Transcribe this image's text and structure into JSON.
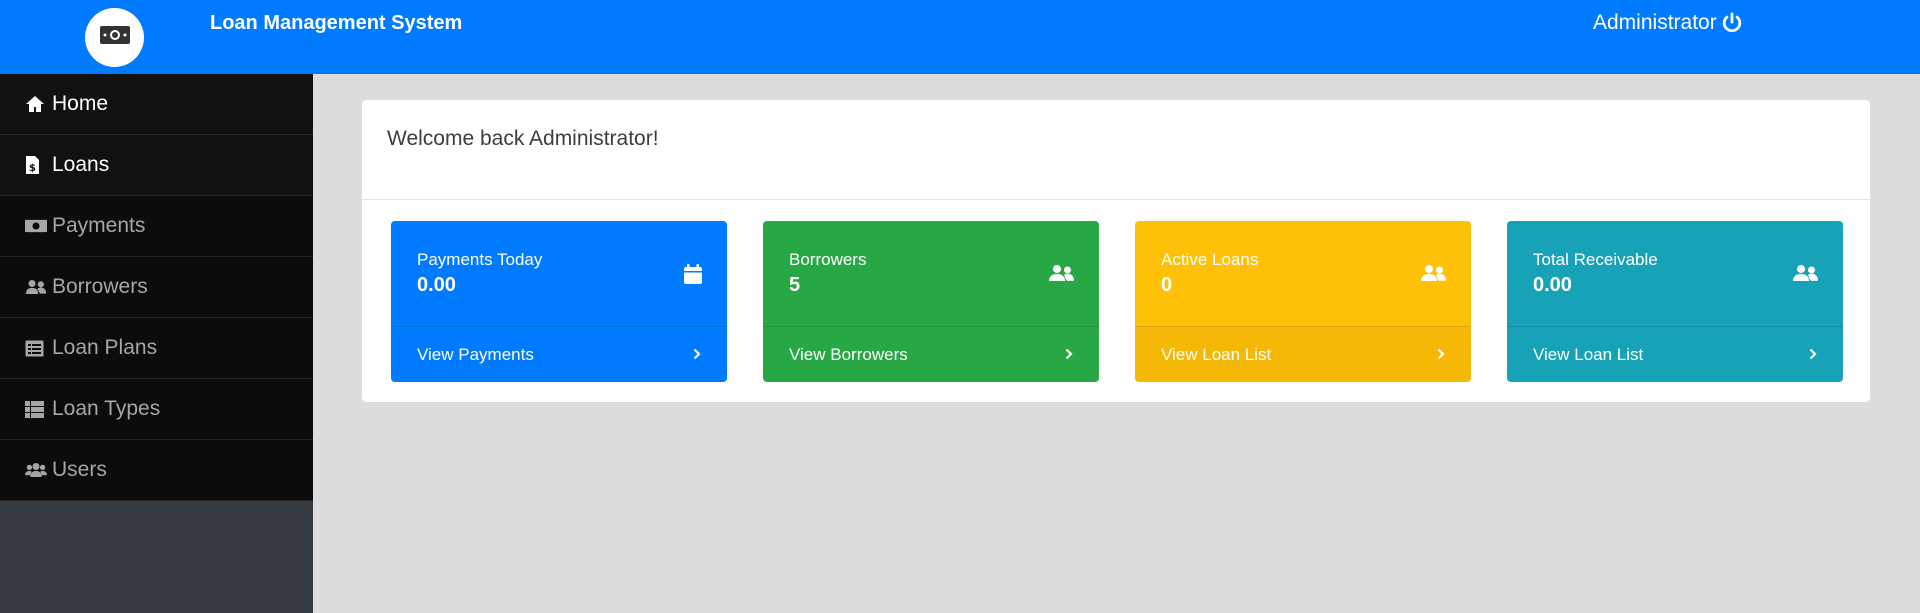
{
  "header": {
    "app_title": "Loan Management System",
    "user_name": "Administrator",
    "brand_color": "#007bff"
  },
  "sidebar": {
    "items": [
      {
        "label": "Home",
        "icon": "home-icon",
        "active": true
      },
      {
        "label": "Loans",
        "icon": "file-dollar-icon",
        "active": true
      },
      {
        "label": "Payments",
        "icon": "money-bill-icon",
        "active": false
      },
      {
        "label": "Borrowers",
        "icon": "users-icon",
        "active": false
      },
      {
        "label": "Loan Plans",
        "icon": "list-alt-icon",
        "active": false
      },
      {
        "label": "Loan Types",
        "icon": "th-list-icon",
        "active": false
      },
      {
        "label": "Users",
        "icon": "users-cog-icon",
        "active": false
      }
    ]
  },
  "main": {
    "welcome": "Welcome back Administrator!",
    "tiles": [
      {
        "label": "Payments Today",
        "value": "0.00",
        "link": "View Payments",
        "icon": "calendar-icon",
        "color": "#007bff"
      },
      {
        "label": "Borrowers",
        "value": "5",
        "link": "View Borrowers",
        "icon": "user-friends-icon",
        "color": "#28a745"
      },
      {
        "label": "Active Loans",
        "value": "0",
        "link": "View Loan List",
        "icon": "user-friends-icon",
        "color": "#ffc107"
      },
      {
        "label": "Total Receivable",
        "value": "0.00",
        "link": "View Loan List",
        "icon": "user-friends-icon",
        "color": "#17a2b8"
      }
    ]
  }
}
